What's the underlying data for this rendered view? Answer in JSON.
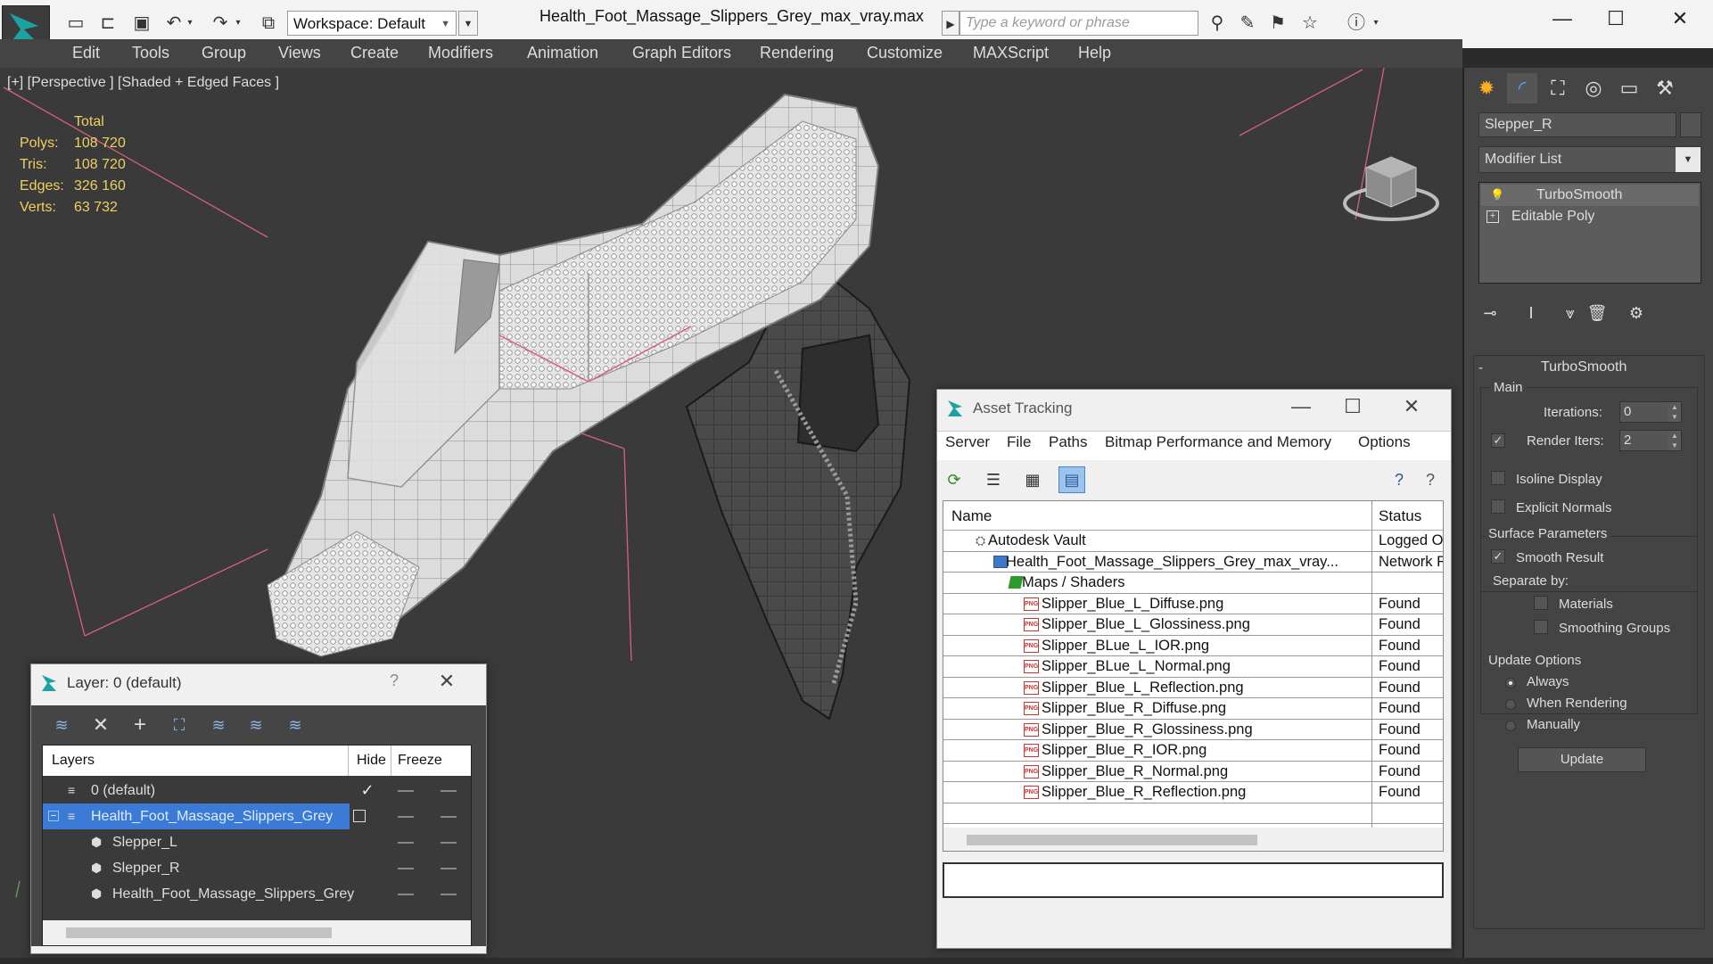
{
  "app": {
    "workspace_label": "Workspace: Default",
    "file_title": "Health_Foot_Massage_Slippers_Grey_max_vray.max",
    "search_placeholder": "Type a keyword or phrase"
  },
  "menu": [
    "Edit",
    "Tools",
    "Group",
    "Views",
    "Create",
    "Modifiers",
    "Animation",
    "Graph Editors",
    "Rendering",
    "Customize",
    "MAXScript",
    "Help"
  ],
  "viewport": {
    "label": "[+] [Perspective ] [Shaded + Edged Faces ]",
    "stats": {
      "header": "Total",
      "rows": [
        {
          "label": "Polys:",
          "value": "108 720"
        },
        {
          "label": "Tris:",
          "value": "108 720"
        },
        {
          "label": "Edges:",
          "value": "326 160"
        },
        {
          "label": "Verts:",
          "value": "63 732"
        }
      ]
    }
  },
  "command_panel": {
    "object_name": "Slepper_R",
    "modifier_list": "Modifier List",
    "stack": [
      "TurboSmooth",
      "Editable Poly"
    ],
    "rollout_title": "TurboSmooth",
    "main_group": "Main",
    "iterations_label": "Iterations:",
    "iterations_value": "0",
    "render_iters_label": "Render Iters:",
    "render_iters_value": "2",
    "isoline_label": "Isoline Display",
    "explicit_normals_label": "Explicit Normals",
    "surface_group": "Surface Parameters",
    "smooth_result_label": "Smooth Result",
    "separate_by_label": "Separate by:",
    "materials_label": "Materials",
    "smoothing_groups_label": "Smoothing Groups",
    "update_group": "Update Options",
    "always_label": "Always",
    "when_rendering_label": "When Rendering",
    "manually_label": "Manually",
    "update_button": "Update"
  },
  "asset_tracking": {
    "title": "Asset Tracking",
    "menu": [
      "Server",
      "File",
      "Paths",
      "Bitmap Performance and Memory",
      "Options"
    ],
    "col_name": "Name",
    "col_status": "Status",
    "rows": [
      {
        "name": "Autodesk Vault",
        "status": "Logged O"
      },
      {
        "name": "Health_Foot_Massage_Slippers_Grey_max_vray...",
        "status": "Network F"
      },
      {
        "name": "Maps / Shaders",
        "status": ""
      },
      {
        "name": "Slipper_Blue_L_Diffuse.png",
        "status": "Found"
      },
      {
        "name": "Slipper_Blue_L_Glossiness.png",
        "status": "Found"
      },
      {
        "name": "Slipper_BLue_L_IOR.png",
        "status": "Found"
      },
      {
        "name": "Slipper_BLue_L_Normal.png",
        "status": "Found"
      },
      {
        "name": "Slipper_Blue_L_Reflection.png",
        "status": "Found"
      },
      {
        "name": "Slipper_Blue_R_Diffuse.png",
        "status": "Found"
      },
      {
        "name": "Slipper_Blue_R_Glossiness.png",
        "status": "Found"
      },
      {
        "name": "Slipper_Blue_R_IOR.png",
        "status": "Found"
      },
      {
        "name": "Slipper_Blue_R_Normal.png",
        "status": "Found"
      },
      {
        "name": "Slipper_Blue_R_Reflection.png",
        "status": "Found"
      }
    ],
    "png_badge": "PNG"
  },
  "layer_dialog": {
    "title": "Layer: 0 (default)",
    "help": "?",
    "col_layers": "Layers",
    "col_hide": "Hide",
    "col_freeze": "Freeze",
    "rows": [
      {
        "name": "0 (default)"
      },
      {
        "name": "Health_Foot_Massage_Slippers_Grey"
      },
      {
        "name": "Slepper_L"
      },
      {
        "name": "Slepper_R"
      },
      {
        "name": "Health_Foot_Massage_Slippers_Grey"
      }
    ]
  },
  "colors": {
    "stats_yellow": "#f0d060",
    "selection_blue": "#3b7bd6",
    "viewport_bg": "#3a3a3a"
  }
}
